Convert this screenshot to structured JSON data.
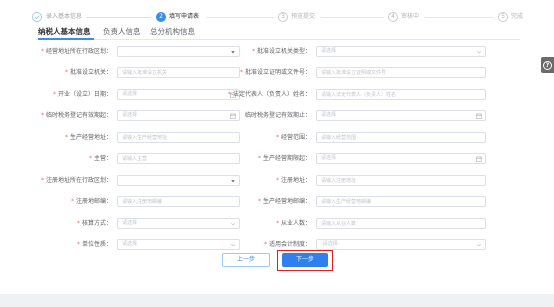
{
  "steps": [
    {
      "label": "录入基本信息",
      "completed": true,
      "icon": "check-icon"
    },
    {
      "number": "2",
      "label": "填写申请表",
      "current": true
    },
    {
      "number": "3",
      "label": "预览提交"
    },
    {
      "number": "4",
      "label": "审核中"
    },
    {
      "number": "5",
      "label": "完成"
    }
  ],
  "tabs": [
    {
      "label": "纳税人基本信息",
      "active": true
    },
    {
      "label": "负责人信息",
      "active": false
    },
    {
      "label": "总分机构信息",
      "active": false
    }
  ],
  "form": {
    "required_mark": "*",
    "rows": [
      {
        "left": {
          "label": "经营地址所在行政区划：",
          "required": true,
          "icon": "caret-down-icon"
        },
        "right": {
          "label": "批准设立机关类型：",
          "required": true,
          "placeholder": "请选择",
          "icon": "chevron-down-icon"
        }
      },
      {
        "left": {
          "label": "批准设立机关：",
          "required": true,
          "placeholder": "请输入批准设立机关"
        },
        "right": {
          "label": "批准设立证明或文件号：",
          "required": true,
          "placeholder": "请输入批准设立证明或文件号"
        }
      },
      {
        "left": {
          "label": "开业（设立）日期：",
          "required": true,
          "placeholder": "请选择",
          "icon": "calendar-icon"
        },
        "right": {
          "label": "法定代表人（负责人）姓名：",
          "required": true,
          "placeholder": "请输入法定代表人（负责人）姓名"
        }
      },
      {
        "left": {
          "label": "临时税务登记有效期起：",
          "required": true,
          "placeholder": "请选择",
          "icon": "calendar-icon"
        },
        "right": {
          "label": "临时税务登记有效期止：",
          "required": false,
          "placeholder": "请选择",
          "icon": "calendar-icon"
        }
      },
      {
        "left": {
          "label": "生产经营地址：",
          "required": true,
          "placeholder": "请输入生产经营地址"
        },
        "right": {
          "label": "经营范围：",
          "required": true,
          "placeholder": "请输入经营范围"
        }
      },
      {
        "left": {
          "label": "主营：",
          "required": true,
          "placeholder": "请输入主营"
        },
        "right": {
          "label": "生产经营期限起：",
          "required": true,
          "placeholder": "请选择",
          "icon": "calendar-icon"
        }
      },
      {
        "left": {
          "label": "注册地址所在行政区划：",
          "required": true,
          "icon": "caret-down-icon"
        },
        "right": {
          "label": "注册地址：",
          "required": true,
          "placeholder": "请输入注册地址"
        }
      },
      {
        "left": {
          "label": "注册地邮编：",
          "required": true,
          "placeholder": "请输入注册地邮编"
        },
        "right": {
          "label": "生产经营地邮编：",
          "required": true,
          "placeholder": "请输入生产经营地邮编"
        }
      },
      {
        "left": {
          "label": "核算方式：",
          "required": true,
          "placeholder": "请选择",
          "icon": "chevron-down-icon"
        },
        "right": {
          "label": "从业人数：",
          "required": true,
          "placeholder": "请输入从业人数"
        }
      },
      {
        "left": {
          "label": "单位性质：",
          "required": true,
          "placeholder": "请选择",
          "icon": "chevron-down-icon"
        },
        "right": {
          "label": "适用会计制度：",
          "required": true,
          "placeholder": "-请选择-",
          "icon": "chevron-down-icon"
        }
      }
    ]
  },
  "buttons": {
    "prev": "上一步",
    "next": "下一步"
  },
  "help": {
    "glyph": "?",
    "icon": "question-icon"
  },
  "colors": {
    "primary": "#3a8ee6",
    "required": "#f56c6c",
    "highlight": "#e02020",
    "footer": "#f0f1f3"
  }
}
